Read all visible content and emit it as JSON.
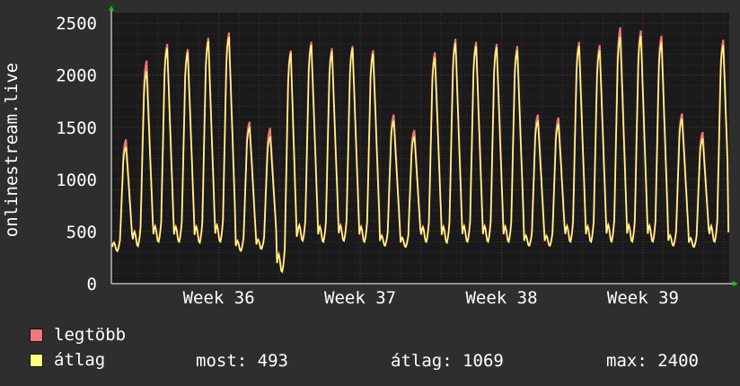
{
  "colors": {
    "background": "#2e2e2e",
    "plot_background": "#1a1a1a",
    "grid_major": "#5a3a3a",
    "grid_minor": "#3c3232",
    "axis": "#ffffff",
    "max_series": "#f07878",
    "avg_series": "#ffff80",
    "arrow": "#00cc00"
  },
  "chart_data": {
    "type": "line",
    "ylabel": "onlinestream.live",
    "ylim": [
      0,
      2600
    ],
    "y_ticks": [
      0,
      500,
      1000,
      1500,
      2000,
      2500
    ],
    "x_ticks": [
      "Week 36",
      "Week 37",
      "Week 38",
      "Week 39"
    ],
    "xlim_weeks": [
      35.24,
      39.61
    ],
    "grid": true,
    "series": [
      {
        "name": "legtöbb",
        "color": "#f07878"
      },
      {
        "name": "átlag",
        "color": "#ffff80"
      }
    ],
    "daily_peaks_avg": [
      1320,
      2050,
      2270,
      2230,
      2340,
      2380,
      1510,
      1420,
      2230,
      2300,
      2240,
      2270,
      2220,
      1570,
      1420,
      2180,
      2320,
      2290,
      2280,
      2250,
      1570,
      1540,
      2290,
      2250,
      2380,
      2390,
      2330,
      1590,
      1400,
      2300
    ],
    "daily_peaks_max": [
      1390,
      2150,
      2310,
      2260,
      2370,
      2420,
      1560,
      1500,
      2250,
      2330,
      2270,
      2290,
      2250,
      1630,
      1480,
      2230,
      2360,
      2330,
      2310,
      2290,
      1630,
      1600,
      2330,
      2300,
      2470,
      2440,
      2390,
      1640,
      1460,
      2350
    ],
    "daily_troughs": [
      300,
      340,
      380,
      380,
      370,
      380,
      300,
      320,
      90,
      390,
      380,
      390,
      380,
      350,
      340,
      380,
      370,
      380,
      380,
      380,
      350,
      350,
      380,
      380,
      380,
      380,
      380,
      350,
      340,
      380
    ],
    "last_value": 493
  },
  "legend": {
    "max_label": "legtöbb",
    "avg_label": "átlag"
  },
  "stats": {
    "now": "most: 493",
    "avg": "átlag: 1069",
    "max": "max: 2400"
  }
}
